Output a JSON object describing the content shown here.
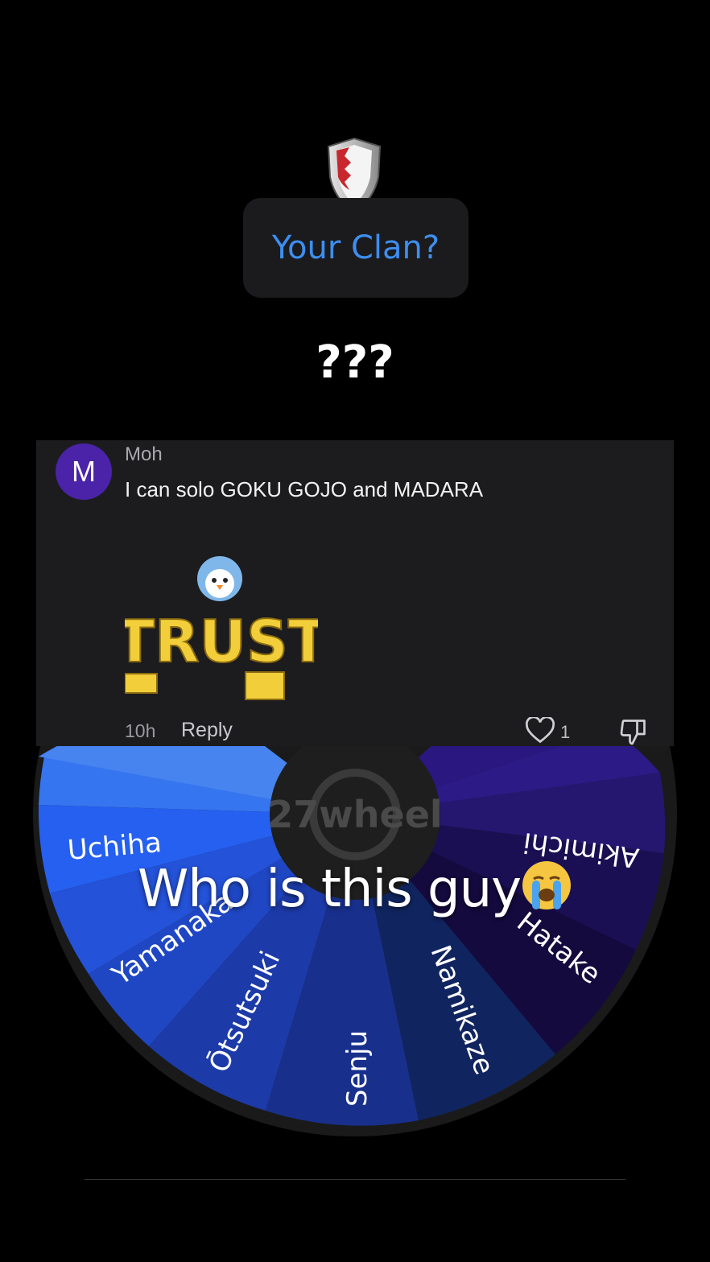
{
  "header": {
    "question": "Your Clan?",
    "reaction": "???"
  },
  "comment": {
    "avatar_letter": "M",
    "avatar_color": "#4a23a8",
    "username": "Moh",
    "text": "I can solo GOKU GOJO and MADARA",
    "sticker_text": "TRUST",
    "time": "10h",
    "reply_label": "Reply",
    "like_count": "1"
  },
  "wheel": {
    "watermark": "27wheel",
    "segments": [
      "Uchiha",
      "Yamanaka",
      "Ōtsutsuki",
      "Senju",
      "Namikaze",
      "Hatake",
      "Akimichi"
    ]
  },
  "overlay": {
    "text": "Who is this guy"
  },
  "colors": {
    "accent_link": "#3d8ef0",
    "comment_bg": "#1c1c1e"
  }
}
